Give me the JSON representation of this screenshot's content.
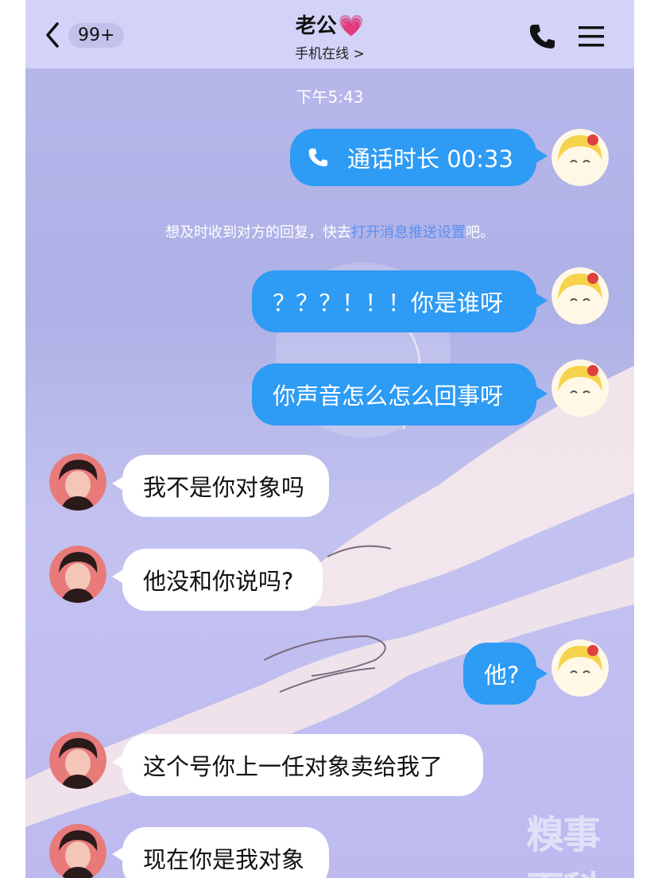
{
  "header": {
    "back_badge": "99+",
    "title": "老公",
    "heart_icon": "heart-emoji",
    "subtitle": "手机在线 >",
    "accent": "#d3d2f7"
  },
  "chat": {
    "timestamp": "下午5:43",
    "call_label": "通话时长 00:33",
    "notice_prefix": "想及时收到对方的回复，快去",
    "notice_link": "打开消息推送设置",
    "notice_suffix": "吧。",
    "messages": [
      {
        "side": "me",
        "text": "？？？！！！你是谁呀"
      },
      {
        "side": "me",
        "text": "你声音怎么怎么回事呀"
      },
      {
        "side": "them",
        "text": "我不是你对象吗"
      },
      {
        "side": "them",
        "text": "他没和你说吗?"
      },
      {
        "side": "me",
        "text": "他?"
      },
      {
        "side": "them",
        "text": "这个号你上一任对象卖给我了"
      },
      {
        "side": "them",
        "text": "现在你是我对象"
      }
    ],
    "my_bubble_color": "#2e9bf4",
    "their_bubble_color": "#ffffff"
  },
  "watermark": "糗事百科"
}
